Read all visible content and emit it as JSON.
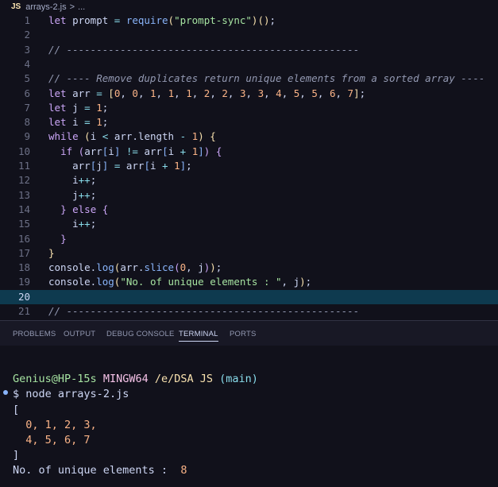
{
  "breadcrumb": {
    "file_badge": "JS",
    "file_name": "arrays-2.js",
    "separator": ">",
    "ellipsis": "..."
  },
  "editor": {
    "active_line": 20,
    "line_numbers": [
      "1",
      "2",
      "3",
      "4",
      "5",
      "6",
      "7",
      "8",
      "9",
      "10",
      "11",
      "12",
      "13",
      "14",
      "15",
      "16",
      "17",
      "18",
      "19",
      "20",
      "21"
    ]
  },
  "panel": {
    "tabs": [
      "PROBLEMS",
      "OUTPUT",
      "DEBUG CONSOLE",
      "TERMINAL",
      "PORTS"
    ],
    "active_tab": "TERMINAL"
  },
  "terminal": {
    "user_host": "Genius@HP-15s",
    "shell": "MINGW64",
    "path": "/e/DSA JS",
    "branch": "(main)",
    "prompt_symbol": "$",
    "command": "node arrays-2.js",
    "output_open": "[",
    "output_row1": "  0, 1, 2, 3,",
    "output_row2": "  4, 5, 6, 7",
    "output_close": "]",
    "unique_label": "No. of unique elements :",
    "unique_value": "8"
  },
  "colors": {
    "editor_bg": "#11111b",
    "active_line_bg": "#0e3a4f",
    "keyword": "#cba6f7",
    "string": "#a6e3a1",
    "number": "#fab387",
    "function": "#89b4fa"
  }
}
